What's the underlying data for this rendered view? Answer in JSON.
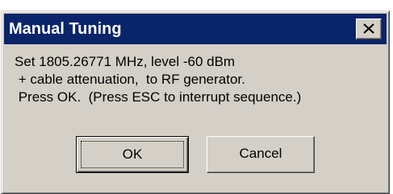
{
  "window": {
    "title": "Manual Tuning",
    "close_icon": "close-icon",
    "title_bar_color": "#0a246a",
    "face_color": "#d4d0c8"
  },
  "message": {
    "lines": [
      "Set 1805.26771 MHz, level -60 dBm",
      " + cable attenuation,  to RF generator.",
      " Press OK.  (Press ESC to interrupt sequence.)"
    ]
  },
  "buttons": {
    "ok_label": "OK",
    "cancel_label": "Cancel"
  }
}
